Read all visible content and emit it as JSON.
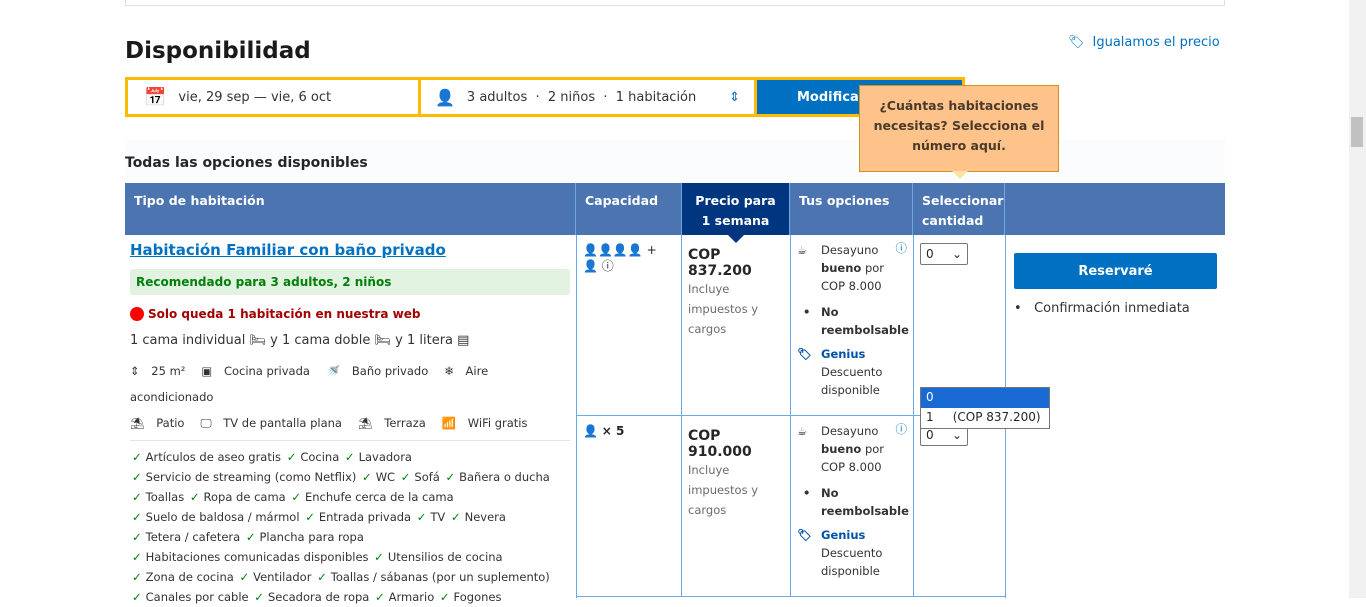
{
  "header": {
    "title": "Disponibilidad",
    "price_match": "Igualamos el precio"
  },
  "search": {
    "dates": "vie, 29 sep — vie, 6 oct",
    "guests": "3 adultos  ·  2 niños  ·  1 habitación",
    "modify": "Modificar búsqueda"
  },
  "tooltip": "¿Cuántas habitaciones necesitas? Selecciona el número aquí.",
  "subtitle": "Todas las opciones disponibles",
  "columns": [
    "Tipo de habitación",
    "Capacidad",
    "Precio para 1 semana",
    "Tus opciones",
    "Seleccionar cantidad"
  ],
  "room": {
    "name": "Habitación Familiar con baño privado",
    "recommended": "Recomendado para 3 adultos, 2 niños",
    "scarcity": "Solo queda 1 habitación en nuestra web",
    "beds": [
      "1 cama individual",
      "y 1 cama doble",
      "y 1 litera"
    ],
    "facilities": [
      "25 m²",
      "Cocina privada",
      "Baño privado",
      "Aire acondicionado",
      "Patio",
      "TV de pantalla plana",
      "Terraza",
      "WiFi gratis"
    ],
    "amenity_rows": [
      [
        "Artículos de aseo gratis",
        "Cocina",
        "Lavadora"
      ],
      [
        "Servicio de streaming (como Netflix)",
        "WC",
        "Sofá",
        "Bañera o ducha"
      ],
      [
        "Toallas",
        "Ropa de cama",
        "Enchufe cerca de la cama"
      ],
      [
        "Suelo de baldosa / mármol",
        "Entrada privada",
        "TV",
        "Nevera"
      ],
      [
        "Tetera / cafetera",
        "Plancha para ropa"
      ],
      [
        "Habitaciones comunicadas disponibles",
        "Utensilios de cocina"
      ],
      [
        "Zona de cocina",
        "Ventilador",
        "Toallas / sábanas (por un suplemento)"
      ],
      [
        "Canales por cable",
        "Secadora de ropa",
        "Armario",
        "Fogones"
      ]
    ]
  },
  "options": [
    {
      "capacity": "4 adultos + 1 niño",
      "price": "COP 837.200",
      "taxes": "Incluye impuestos y cargos",
      "breakfast_pre": "Desayuno ",
      "breakfast_bold": "bueno",
      "breakfast_post": " por COP 8.000",
      "refund": "No reembolsable",
      "genius": "Genius",
      "genius_desc": "Descuento disponible",
      "qty": "0"
    },
    {
      "capacity": "× 5",
      "price": "COP 910.000",
      "taxes": "Incluye impuestos y cargos",
      "breakfast_pre": "Desayuno ",
      "breakfast_bold": "bueno",
      "breakfast_post": " por COP 8.000",
      "refund": "No reembolsable",
      "genius": "Genius",
      "genius_desc": "Descuento disponible",
      "qty": "0"
    }
  ],
  "dropdown": {
    "options": [
      "0",
      "1     (COP 837.200)"
    ],
    "selected": "0"
  },
  "reserve": {
    "button": "Reservaré",
    "confirmation": "Confirmación inmediata"
  }
}
